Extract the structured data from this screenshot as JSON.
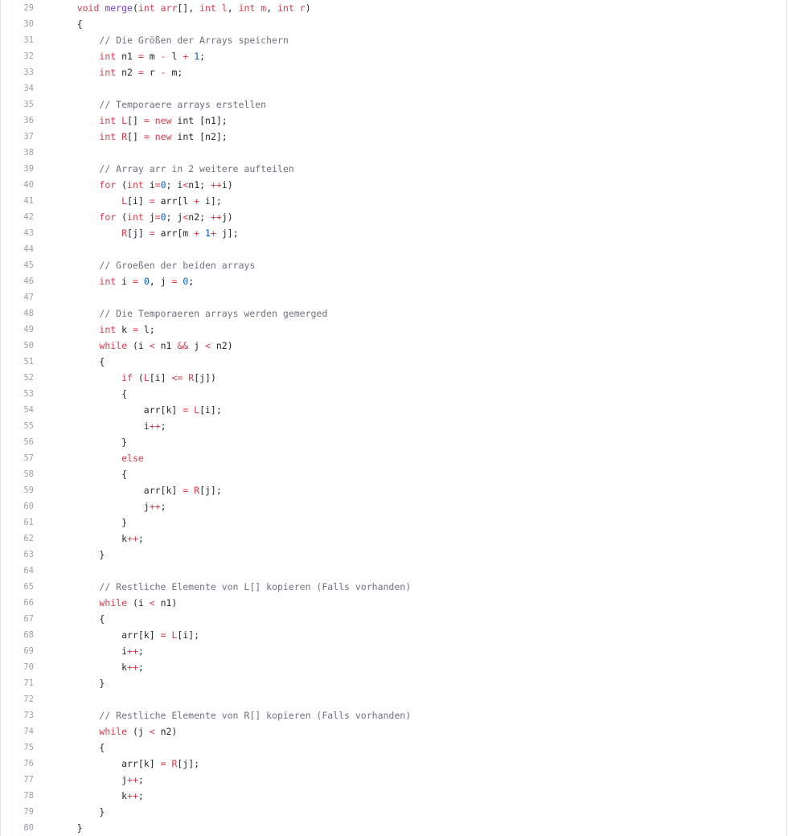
{
  "code": {
    "lines": [
      {
        "n": "29",
        "tokens": [
          {
            "t": "    "
          },
          {
            "t": "void ",
            "c": "kw"
          },
          {
            "t": "merge",
            "c": "fn"
          },
          {
            "t": "("
          },
          {
            "t": "int ",
            "c": "kw"
          },
          {
            "t": "arr",
            "c": "kw"
          },
          {
            "t": "[], "
          },
          {
            "t": "int ",
            "c": "kw"
          },
          {
            "t": "l",
            "c": "kw"
          },
          {
            "t": ", "
          },
          {
            "t": "int ",
            "c": "kw"
          },
          {
            "t": "m",
            "c": "kw"
          },
          {
            "t": ", "
          },
          {
            "t": "int ",
            "c": "kw"
          },
          {
            "t": "r",
            "c": "kw"
          },
          {
            "t": ")"
          }
        ]
      },
      {
        "n": "30",
        "tokens": [
          {
            "t": "    {"
          }
        ]
      },
      {
        "n": "31",
        "tokens": [
          {
            "t": "        "
          },
          {
            "t": "// Die Größen der Arrays speichern",
            "c": "cm"
          }
        ]
      },
      {
        "n": "32",
        "tokens": [
          {
            "t": "        "
          },
          {
            "t": "int",
            "c": "kw"
          },
          {
            "t": " n1 "
          },
          {
            "t": "=",
            "c": "kw"
          },
          {
            "t": " m "
          },
          {
            "t": "-",
            "c": "kw"
          },
          {
            "t": " l "
          },
          {
            "t": "+",
            "c": "kw"
          },
          {
            "t": " "
          },
          {
            "t": "1",
            "c": "num"
          },
          {
            "t": ";"
          }
        ]
      },
      {
        "n": "33",
        "tokens": [
          {
            "t": "        "
          },
          {
            "t": "int",
            "c": "kw"
          },
          {
            "t": " n2 "
          },
          {
            "t": "=",
            "c": "kw"
          },
          {
            "t": " r "
          },
          {
            "t": "-",
            "c": "kw"
          },
          {
            "t": " m;"
          }
        ]
      },
      {
        "n": "34",
        "tokens": []
      },
      {
        "n": "35",
        "tokens": [
          {
            "t": "        "
          },
          {
            "t": "// Temporaere arrays erstellen",
            "c": "cm"
          }
        ]
      },
      {
        "n": "36",
        "tokens": [
          {
            "t": "        "
          },
          {
            "t": "int",
            "c": "kw"
          },
          {
            "t": " "
          },
          {
            "t": "L",
            "c": "kw"
          },
          {
            "t": "[] "
          },
          {
            "t": "=",
            "c": "kw"
          },
          {
            "t": " "
          },
          {
            "t": "new",
            "c": "kw"
          },
          {
            "t": " int [n1];"
          }
        ]
      },
      {
        "n": "37",
        "tokens": [
          {
            "t": "        "
          },
          {
            "t": "int",
            "c": "kw"
          },
          {
            "t": " "
          },
          {
            "t": "R",
            "c": "kw"
          },
          {
            "t": "[] "
          },
          {
            "t": "=",
            "c": "kw"
          },
          {
            "t": " "
          },
          {
            "t": "new",
            "c": "kw"
          },
          {
            "t": " int [n2];"
          }
        ]
      },
      {
        "n": "38",
        "tokens": []
      },
      {
        "n": "39",
        "tokens": [
          {
            "t": "        "
          },
          {
            "t": "// Array arr in 2 weitere aufteilen",
            "c": "cm"
          }
        ]
      },
      {
        "n": "40",
        "tokens": [
          {
            "t": "        "
          },
          {
            "t": "for",
            "c": "kw"
          },
          {
            "t": " ("
          },
          {
            "t": "int",
            "c": "kw"
          },
          {
            "t": " i"
          },
          {
            "t": "=",
            "c": "kw"
          },
          {
            "t": "0",
            "c": "num"
          },
          {
            "t": "; i"
          },
          {
            "t": "<",
            "c": "kw"
          },
          {
            "t": "n1; "
          },
          {
            "t": "++",
            "c": "kw"
          },
          {
            "t": "i)"
          }
        ]
      },
      {
        "n": "41",
        "tokens": [
          {
            "t": "            "
          },
          {
            "t": "L",
            "c": "kw"
          },
          {
            "t": "[i] "
          },
          {
            "t": "=",
            "c": "kw"
          },
          {
            "t": " arr[l "
          },
          {
            "t": "+",
            "c": "kw"
          },
          {
            "t": " i];"
          }
        ]
      },
      {
        "n": "42",
        "tokens": [
          {
            "t": "        "
          },
          {
            "t": "for",
            "c": "kw"
          },
          {
            "t": " ("
          },
          {
            "t": "int",
            "c": "kw"
          },
          {
            "t": " j"
          },
          {
            "t": "=",
            "c": "kw"
          },
          {
            "t": "0",
            "c": "num"
          },
          {
            "t": "; j"
          },
          {
            "t": "<",
            "c": "kw"
          },
          {
            "t": "n2; "
          },
          {
            "t": "++",
            "c": "kw"
          },
          {
            "t": "j)"
          }
        ]
      },
      {
        "n": "43",
        "tokens": [
          {
            "t": "            "
          },
          {
            "t": "R",
            "c": "kw"
          },
          {
            "t": "[j] "
          },
          {
            "t": "=",
            "c": "kw"
          },
          {
            "t": " arr[m "
          },
          {
            "t": "+",
            "c": "kw"
          },
          {
            "t": " "
          },
          {
            "t": "1",
            "c": "num"
          },
          {
            "t": "+",
            "c": "kw"
          },
          {
            "t": " j];"
          }
        ]
      },
      {
        "n": "44",
        "tokens": []
      },
      {
        "n": "45",
        "tokens": [
          {
            "t": "        "
          },
          {
            "t": "// Groeßen der beiden arrays",
            "c": "cm"
          }
        ]
      },
      {
        "n": "46",
        "tokens": [
          {
            "t": "        "
          },
          {
            "t": "int",
            "c": "kw"
          },
          {
            "t": " i "
          },
          {
            "t": "=",
            "c": "kw"
          },
          {
            "t": " "
          },
          {
            "t": "0",
            "c": "num"
          },
          {
            "t": ", j "
          },
          {
            "t": "=",
            "c": "kw"
          },
          {
            "t": " "
          },
          {
            "t": "0",
            "c": "num"
          },
          {
            "t": ";"
          }
        ]
      },
      {
        "n": "47",
        "tokens": []
      },
      {
        "n": "48",
        "tokens": [
          {
            "t": "        "
          },
          {
            "t": "// Die Temporaeren arrays werden gemerged",
            "c": "cm"
          }
        ]
      },
      {
        "n": "49",
        "tokens": [
          {
            "t": "        "
          },
          {
            "t": "int",
            "c": "kw"
          },
          {
            "t": " k "
          },
          {
            "t": "=",
            "c": "kw"
          },
          {
            "t": " l;"
          }
        ]
      },
      {
        "n": "50",
        "tokens": [
          {
            "t": "        "
          },
          {
            "t": "while",
            "c": "kw"
          },
          {
            "t": " (i "
          },
          {
            "t": "<",
            "c": "kw"
          },
          {
            "t": " n1 "
          },
          {
            "t": "&&",
            "c": "kw"
          },
          {
            "t": " j "
          },
          {
            "t": "<",
            "c": "kw"
          },
          {
            "t": " n2)"
          }
        ]
      },
      {
        "n": "51",
        "tokens": [
          {
            "t": "        {"
          }
        ]
      },
      {
        "n": "52",
        "tokens": [
          {
            "t": "            "
          },
          {
            "t": "if",
            "c": "kw"
          },
          {
            "t": " ("
          },
          {
            "t": "L",
            "c": "kw"
          },
          {
            "t": "[i] "
          },
          {
            "t": "<=",
            "c": "kw"
          },
          {
            "t": " "
          },
          {
            "t": "R",
            "c": "kw"
          },
          {
            "t": "[j])"
          }
        ]
      },
      {
        "n": "53",
        "tokens": [
          {
            "t": "            {"
          }
        ]
      },
      {
        "n": "54",
        "tokens": [
          {
            "t": "                arr[k] "
          },
          {
            "t": "=",
            "c": "kw"
          },
          {
            "t": " "
          },
          {
            "t": "L",
            "c": "kw"
          },
          {
            "t": "[i];"
          }
        ]
      },
      {
        "n": "55",
        "tokens": [
          {
            "t": "                i"
          },
          {
            "t": "++",
            "c": "kw"
          },
          {
            "t": ";"
          }
        ]
      },
      {
        "n": "56",
        "tokens": [
          {
            "t": "            }"
          }
        ]
      },
      {
        "n": "57",
        "tokens": [
          {
            "t": "            "
          },
          {
            "t": "else",
            "c": "kw"
          }
        ]
      },
      {
        "n": "58",
        "tokens": [
          {
            "t": "            {"
          }
        ]
      },
      {
        "n": "59",
        "tokens": [
          {
            "t": "                arr[k] "
          },
          {
            "t": "=",
            "c": "kw"
          },
          {
            "t": " "
          },
          {
            "t": "R",
            "c": "kw"
          },
          {
            "t": "[j];"
          }
        ]
      },
      {
        "n": "60",
        "tokens": [
          {
            "t": "                j"
          },
          {
            "t": "++",
            "c": "kw"
          },
          {
            "t": ";"
          }
        ]
      },
      {
        "n": "61",
        "tokens": [
          {
            "t": "            }"
          }
        ]
      },
      {
        "n": "62",
        "tokens": [
          {
            "t": "            k"
          },
          {
            "t": "++",
            "c": "kw"
          },
          {
            "t": ";"
          }
        ]
      },
      {
        "n": "63",
        "tokens": [
          {
            "t": "        }"
          }
        ]
      },
      {
        "n": "64",
        "tokens": []
      },
      {
        "n": "65",
        "tokens": [
          {
            "t": "        "
          },
          {
            "t": "// Restliche Elemente von L[] kopieren (Falls vorhanden)",
            "c": "cm"
          }
        ]
      },
      {
        "n": "66",
        "tokens": [
          {
            "t": "        "
          },
          {
            "t": "while",
            "c": "kw"
          },
          {
            "t": " (i "
          },
          {
            "t": "<",
            "c": "kw"
          },
          {
            "t": " n1)"
          }
        ]
      },
      {
        "n": "67",
        "tokens": [
          {
            "t": "        {"
          }
        ]
      },
      {
        "n": "68",
        "tokens": [
          {
            "t": "            arr[k] "
          },
          {
            "t": "=",
            "c": "kw"
          },
          {
            "t": " "
          },
          {
            "t": "L",
            "c": "kw"
          },
          {
            "t": "[i];"
          }
        ]
      },
      {
        "n": "69",
        "tokens": [
          {
            "t": "            i"
          },
          {
            "t": "++",
            "c": "kw"
          },
          {
            "t": ";"
          }
        ]
      },
      {
        "n": "70",
        "tokens": [
          {
            "t": "            k"
          },
          {
            "t": "++",
            "c": "kw"
          },
          {
            "t": ";"
          }
        ]
      },
      {
        "n": "71",
        "tokens": [
          {
            "t": "        }"
          }
        ]
      },
      {
        "n": "72",
        "tokens": []
      },
      {
        "n": "73",
        "tokens": [
          {
            "t": "        "
          },
          {
            "t": "// Restliche Elemente von R[] kopieren (Falls vorhanden)",
            "c": "cm"
          }
        ]
      },
      {
        "n": "74",
        "tokens": [
          {
            "t": "        "
          },
          {
            "t": "while",
            "c": "kw"
          },
          {
            "t": " (j "
          },
          {
            "t": "<",
            "c": "kw"
          },
          {
            "t": " n2)"
          }
        ]
      },
      {
        "n": "75",
        "tokens": [
          {
            "t": "        {"
          }
        ]
      },
      {
        "n": "76",
        "tokens": [
          {
            "t": "            arr[k] "
          },
          {
            "t": "=",
            "c": "kw"
          },
          {
            "t": " "
          },
          {
            "t": "R",
            "c": "kw"
          },
          {
            "t": "[j];"
          }
        ]
      },
      {
        "n": "77",
        "tokens": [
          {
            "t": "            j"
          },
          {
            "t": "++",
            "c": "kw"
          },
          {
            "t": ";"
          }
        ]
      },
      {
        "n": "78",
        "tokens": [
          {
            "t": "            k"
          },
          {
            "t": "++",
            "c": "kw"
          },
          {
            "t": ";"
          }
        ]
      },
      {
        "n": "79",
        "tokens": [
          {
            "t": "        }"
          }
        ]
      },
      {
        "n": "80",
        "tokens": [
          {
            "t": "    }"
          }
        ]
      }
    ]
  }
}
